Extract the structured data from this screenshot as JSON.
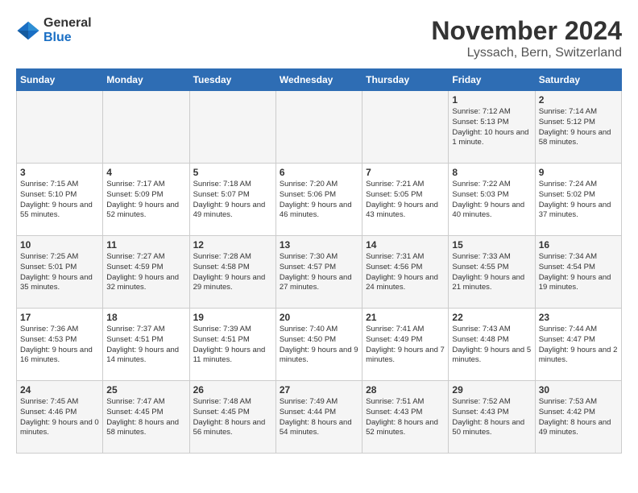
{
  "logo": {
    "general": "General",
    "blue": "Blue"
  },
  "title": {
    "month_year": "November 2024",
    "location": "Lyssach, Bern, Switzerland"
  },
  "headers": [
    "Sunday",
    "Monday",
    "Tuesday",
    "Wednesday",
    "Thursday",
    "Friday",
    "Saturday"
  ],
  "weeks": [
    [
      {
        "day": "",
        "sunrise": "",
        "sunset": "",
        "daylight": ""
      },
      {
        "day": "",
        "sunrise": "",
        "sunset": "",
        "daylight": ""
      },
      {
        "day": "",
        "sunrise": "",
        "sunset": "",
        "daylight": ""
      },
      {
        "day": "",
        "sunrise": "",
        "sunset": "",
        "daylight": ""
      },
      {
        "day": "",
        "sunrise": "",
        "sunset": "",
        "daylight": ""
      },
      {
        "day": "1",
        "sunrise": "Sunrise: 7:12 AM",
        "sunset": "Sunset: 5:13 PM",
        "daylight": "Daylight: 10 hours and 1 minute."
      },
      {
        "day": "2",
        "sunrise": "Sunrise: 7:14 AM",
        "sunset": "Sunset: 5:12 PM",
        "daylight": "Daylight: 9 hours and 58 minutes."
      }
    ],
    [
      {
        "day": "3",
        "sunrise": "Sunrise: 7:15 AM",
        "sunset": "Sunset: 5:10 PM",
        "daylight": "Daylight: 9 hours and 55 minutes."
      },
      {
        "day": "4",
        "sunrise": "Sunrise: 7:17 AM",
        "sunset": "Sunset: 5:09 PM",
        "daylight": "Daylight: 9 hours and 52 minutes."
      },
      {
        "day": "5",
        "sunrise": "Sunrise: 7:18 AM",
        "sunset": "Sunset: 5:07 PM",
        "daylight": "Daylight: 9 hours and 49 minutes."
      },
      {
        "day": "6",
        "sunrise": "Sunrise: 7:20 AM",
        "sunset": "Sunset: 5:06 PM",
        "daylight": "Daylight: 9 hours and 46 minutes."
      },
      {
        "day": "7",
        "sunrise": "Sunrise: 7:21 AM",
        "sunset": "Sunset: 5:05 PM",
        "daylight": "Daylight: 9 hours and 43 minutes."
      },
      {
        "day": "8",
        "sunrise": "Sunrise: 7:22 AM",
        "sunset": "Sunset: 5:03 PM",
        "daylight": "Daylight: 9 hours and 40 minutes."
      },
      {
        "day": "9",
        "sunrise": "Sunrise: 7:24 AM",
        "sunset": "Sunset: 5:02 PM",
        "daylight": "Daylight: 9 hours and 37 minutes."
      }
    ],
    [
      {
        "day": "10",
        "sunrise": "Sunrise: 7:25 AM",
        "sunset": "Sunset: 5:01 PM",
        "daylight": "Daylight: 9 hours and 35 minutes."
      },
      {
        "day": "11",
        "sunrise": "Sunrise: 7:27 AM",
        "sunset": "Sunset: 4:59 PM",
        "daylight": "Daylight: 9 hours and 32 minutes."
      },
      {
        "day": "12",
        "sunrise": "Sunrise: 7:28 AM",
        "sunset": "Sunset: 4:58 PM",
        "daylight": "Daylight: 9 hours and 29 minutes."
      },
      {
        "day": "13",
        "sunrise": "Sunrise: 7:30 AM",
        "sunset": "Sunset: 4:57 PM",
        "daylight": "Daylight: 9 hours and 27 minutes."
      },
      {
        "day": "14",
        "sunrise": "Sunrise: 7:31 AM",
        "sunset": "Sunset: 4:56 PM",
        "daylight": "Daylight: 9 hours and 24 minutes."
      },
      {
        "day": "15",
        "sunrise": "Sunrise: 7:33 AM",
        "sunset": "Sunset: 4:55 PM",
        "daylight": "Daylight: 9 hours and 21 minutes."
      },
      {
        "day": "16",
        "sunrise": "Sunrise: 7:34 AM",
        "sunset": "Sunset: 4:54 PM",
        "daylight": "Daylight: 9 hours and 19 minutes."
      }
    ],
    [
      {
        "day": "17",
        "sunrise": "Sunrise: 7:36 AM",
        "sunset": "Sunset: 4:53 PM",
        "daylight": "Daylight: 9 hours and 16 minutes."
      },
      {
        "day": "18",
        "sunrise": "Sunrise: 7:37 AM",
        "sunset": "Sunset: 4:51 PM",
        "daylight": "Daylight: 9 hours and 14 minutes."
      },
      {
        "day": "19",
        "sunrise": "Sunrise: 7:39 AM",
        "sunset": "Sunset: 4:51 PM",
        "daylight": "Daylight: 9 hours and 11 minutes."
      },
      {
        "day": "20",
        "sunrise": "Sunrise: 7:40 AM",
        "sunset": "Sunset: 4:50 PM",
        "daylight": "Daylight: 9 hours and 9 minutes."
      },
      {
        "day": "21",
        "sunrise": "Sunrise: 7:41 AM",
        "sunset": "Sunset: 4:49 PM",
        "daylight": "Daylight: 9 hours and 7 minutes."
      },
      {
        "day": "22",
        "sunrise": "Sunrise: 7:43 AM",
        "sunset": "Sunset: 4:48 PM",
        "daylight": "Daylight: 9 hours and 5 minutes."
      },
      {
        "day": "23",
        "sunrise": "Sunrise: 7:44 AM",
        "sunset": "Sunset: 4:47 PM",
        "daylight": "Daylight: 9 hours and 2 minutes."
      }
    ],
    [
      {
        "day": "24",
        "sunrise": "Sunrise: 7:45 AM",
        "sunset": "Sunset: 4:46 PM",
        "daylight": "Daylight: 9 hours and 0 minutes."
      },
      {
        "day": "25",
        "sunrise": "Sunrise: 7:47 AM",
        "sunset": "Sunset: 4:45 PM",
        "daylight": "Daylight: 8 hours and 58 minutes."
      },
      {
        "day": "26",
        "sunrise": "Sunrise: 7:48 AM",
        "sunset": "Sunset: 4:45 PM",
        "daylight": "Daylight: 8 hours and 56 minutes."
      },
      {
        "day": "27",
        "sunrise": "Sunrise: 7:49 AM",
        "sunset": "Sunset: 4:44 PM",
        "daylight": "Daylight: 8 hours and 54 minutes."
      },
      {
        "day": "28",
        "sunrise": "Sunrise: 7:51 AM",
        "sunset": "Sunset: 4:43 PM",
        "daylight": "Daylight: 8 hours and 52 minutes."
      },
      {
        "day": "29",
        "sunrise": "Sunrise: 7:52 AM",
        "sunset": "Sunset: 4:43 PM",
        "daylight": "Daylight: 8 hours and 50 minutes."
      },
      {
        "day": "30",
        "sunrise": "Sunrise: 7:53 AM",
        "sunset": "Sunset: 4:42 PM",
        "daylight": "Daylight: 8 hours and 49 minutes."
      }
    ]
  ]
}
